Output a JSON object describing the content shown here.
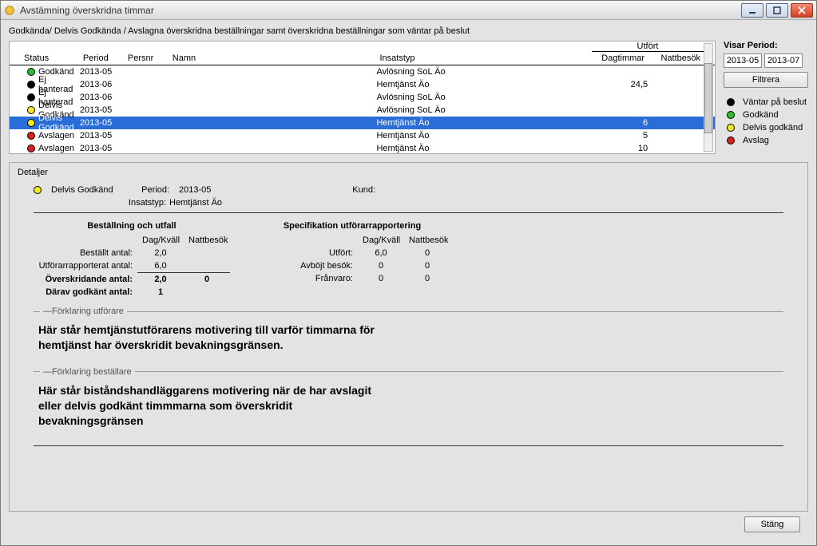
{
  "window": {
    "title": "Avstämning överskridna timmar"
  },
  "breadcrumb": "Godkända/ Delvis Godkända / Avslagna överskridna beställningar samt överskridna beställningar som väntar på beslut",
  "table": {
    "group_header": "Utfört",
    "columns": {
      "status": "Status",
      "period": "Period",
      "persnr": "Persnr",
      "namn": "Namn",
      "insatstyp": "Insatstyp",
      "dagtimmar": "Dagtimmar",
      "nattbesok": "Nattbesök"
    },
    "rows": [
      {
        "status": "Godkänd",
        "color": "#27c22a",
        "period": "2013-05",
        "persnr": "",
        "namn": "",
        "insatstyp": "Avlösning SoL Äo",
        "dag": "",
        "natt": "",
        "selected": false
      },
      {
        "status": "Ej hanterad",
        "color": "#000000",
        "period": "2013-06",
        "persnr": "",
        "namn": "",
        "insatstyp": "Hemtjänst Äo",
        "dag": "24,5",
        "natt": "",
        "selected": false
      },
      {
        "status": "Ej hanterad",
        "color": "#000000",
        "period": "2013-06",
        "persnr": "",
        "namn": "",
        "insatstyp": "Avlösning SoL Äo",
        "dag": "",
        "natt": "",
        "selected": false
      },
      {
        "status": "Delvis Godkänd",
        "color": "#f7e91a",
        "period": "2013-05",
        "persnr": "",
        "namn": "",
        "insatstyp": "Avlösning SoL Äo",
        "dag": "",
        "natt": "",
        "selected": false
      },
      {
        "status": "Delvis Godkänd",
        "color": "#f7e91a",
        "period": "2013-05",
        "persnr": "",
        "namn": "",
        "insatstyp": "Hemtjänst Äo",
        "dag": "6",
        "natt": "",
        "selected": true
      },
      {
        "status": "Avslagen",
        "color": "#d92020",
        "period": "2013-05",
        "persnr": "",
        "namn": "",
        "insatstyp": "Hemtjänst Äo",
        "dag": "5",
        "natt": "",
        "selected": false
      },
      {
        "status": "Avslagen",
        "color": "#d92020",
        "period": "2013-05",
        "persnr": "",
        "namn": "",
        "insatstyp": "Hemtjänst Äo",
        "dag": "10",
        "natt": "",
        "selected": false
      }
    ]
  },
  "filter": {
    "title": "Visar Period:",
    "from": "2013-05",
    "to": "2013-07",
    "button": "Filtrera"
  },
  "legend": [
    {
      "color": "#000000",
      "label": "Väntar på beslut"
    },
    {
      "color": "#27c22a",
      "label": "Godkänd"
    },
    {
      "color": "#f7e91a",
      "label": "Delvis godkänd"
    },
    {
      "color": "#d92020",
      "label": "Avslag"
    }
  ],
  "details": {
    "title": "Detaljer",
    "status_color": "#f7e91a",
    "status": "Delvis Godkänd",
    "period_label": "Period:",
    "period": "2013-05",
    "kund_label": "Kund:",
    "kund": "",
    "insatstyp_label": "Insatstyp:",
    "insatstyp": "Hemtjänst Äo",
    "left": {
      "title": "Beställning och utfall",
      "col1": "Dag/Kväll",
      "col2": "Nattbesök",
      "rows": [
        {
          "label": "Beställt antal:",
          "v1": "2,0",
          "v2": ""
        },
        {
          "label": "Utförarrapporterat antal:",
          "v1": "6,0",
          "v2": ""
        },
        {
          "label": "Överskridande antal:",
          "v1": "2,0",
          "v2": "0",
          "bold": true
        },
        {
          "label": "Därav godkänt antal:",
          "v1": "1",
          "v2": "",
          "bold": true
        }
      ]
    },
    "right": {
      "title": "Specifikation utförarrapportering",
      "col1": "Dag/Kväll",
      "col2": "Nattbesök",
      "rows": [
        {
          "label": "Utfört:",
          "v1": "6,0",
          "v2": "0"
        },
        {
          "label": "Avböjt besök:",
          "v1": "0",
          "v2": "0"
        },
        {
          "label": "Frånvaro:",
          "v1": "0",
          "v2": "0"
        }
      ]
    },
    "forklaring_utforare": {
      "legend": "Förklaring utförare",
      "text": "Här står hemtjänstutförarens motivering till varför timmarna för hemtjänst har överskridit bevakningsgränsen."
    },
    "forklaring_bestallare": {
      "legend": "Förklaring beställare",
      "text": "Här står biståndshandläggarens motivering när de har avslagit eller delvis godkänt timmmarna som överskridit bevakningsgränsen"
    }
  },
  "footer": {
    "close": "Stäng"
  }
}
